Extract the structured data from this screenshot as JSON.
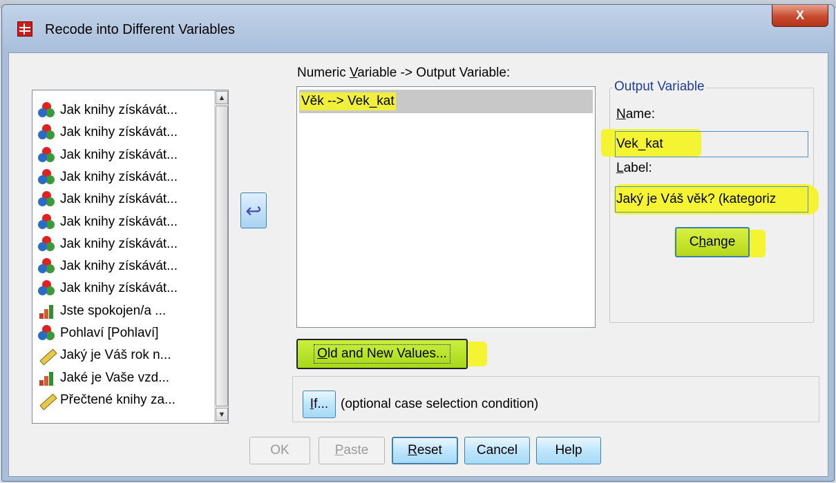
{
  "window": {
    "title": "Recode into Different Variables",
    "close_label": "X"
  },
  "variable_list": {
    "items": [
      {
        "label": "Jak knihy získávát...",
        "icon": "nominal-icon"
      },
      {
        "label": "Jak knihy získávát...",
        "icon": "nominal-icon"
      },
      {
        "label": "Jak knihy získávát...",
        "icon": "nominal-icon"
      },
      {
        "label": "Jak knihy získávát...",
        "icon": "nominal-icon"
      },
      {
        "label": "Jak knihy získávát...",
        "icon": "nominal-icon"
      },
      {
        "label": "Jak knihy získávát...",
        "icon": "nominal-icon"
      },
      {
        "label": "Jak knihy získávát...",
        "icon": "nominal-icon"
      },
      {
        "label": "Jak knihy získávát...",
        "icon": "nominal-icon"
      },
      {
        "label": "Jak knihy získávát...",
        "icon": "nominal-icon"
      },
      {
        "label": "Jste spokojen/a ...",
        "icon": "ordinal-icon"
      },
      {
        "label": "Pohlaví [Pohlaví]",
        "icon": "nominal-icon"
      },
      {
        "label": "Jaký je Váš rok n...",
        "icon": "scale-icon"
      },
      {
        "label": "Jaké je Vaše vzd...",
        "icon": "ordinal-icon"
      },
      {
        "label": "Přečtené knihy za...",
        "icon": "scale-icon"
      }
    ]
  },
  "mapping": {
    "heading_pre": "Numeric ",
    "heading_key": "V",
    "heading_post": "ariable -> Output Variable:",
    "rows": [
      "Věk --> Vek_kat"
    ]
  },
  "output_variable": {
    "group_title": "Output Variable",
    "name_key": "N",
    "name_rest": "ame:",
    "name_value": "Vek_kat",
    "label_key": "L",
    "label_rest": "abel:",
    "label_value": "Jaký je Váš věk? (kategoriz",
    "change_pre": "C",
    "change_key": "h",
    "change_post": "ange"
  },
  "buttons": {
    "old_new_key": "O",
    "old_new_rest": "ld and New Values...",
    "if_key": "I",
    "if_rest": "f...",
    "if_caption": "(optional case selection condition)",
    "ok": "OK",
    "paste_key": "P",
    "paste_rest": "aste",
    "reset_key": "R",
    "reset_rest": "eset",
    "cancel": "Cancel",
    "help": "Help"
  }
}
